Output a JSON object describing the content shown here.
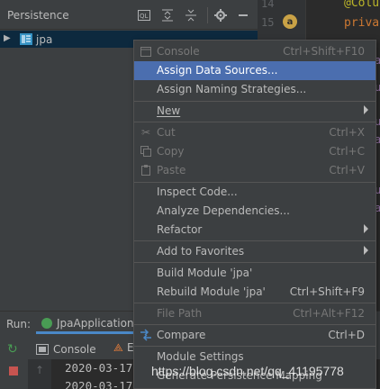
{
  "persistence": {
    "title": "Persistence",
    "tree_item": "jpa"
  },
  "editor": {
    "line_numbers": [
      "14",
      "15"
    ],
    "badge": "a",
    "code_line1": "@Colu",
    "code_line2": "priva",
    "edge_chars": [
      "u",
      "a",
      "u",
      "a",
      "u",
      "a"
    ]
  },
  "run": {
    "label": "Run:",
    "tab_label": "JpaApplication"
  },
  "console": {
    "tab_label": "Console",
    "endpoints_label": "E",
    "log_lines": [
      "2020-03-17",
      "2020-03-17"
    ]
  },
  "menu": {
    "items": [
      {
        "label": "Console",
        "shortcut": "Ctrl+Shift+F10",
        "icon": "console-icon"
      },
      {
        "label": "Assign Data Sources...",
        "shortcut": ""
      },
      {
        "label": "Assign Naming Strategies...",
        "shortcut": ""
      },
      {
        "label": "New",
        "shortcut": ""
      },
      {
        "label": "Cut",
        "shortcut": "Ctrl+X",
        "icon": "scissors-icon"
      },
      {
        "label": "Copy",
        "shortcut": "Ctrl+C",
        "icon": "copy-icon"
      },
      {
        "label": "Paste",
        "shortcut": "Ctrl+V",
        "icon": "paste-icon"
      },
      {
        "label": "Inspect Code...",
        "shortcut": ""
      },
      {
        "label": "Analyze Dependencies...",
        "shortcut": ""
      },
      {
        "label": "Refactor",
        "shortcut": ""
      },
      {
        "label": "Add to Favorites",
        "shortcut": ""
      },
      {
        "label": "Build Module 'jpa'",
        "shortcut": ""
      },
      {
        "label": "Rebuild Module 'jpa'",
        "shortcut": "Ctrl+Shift+F9"
      },
      {
        "label": "File Path",
        "shortcut": "Ctrl+Alt+F12"
      },
      {
        "label": "Compare",
        "shortcut": "Ctrl+D",
        "icon": "compare-icon"
      },
      {
        "label": "Module Settings",
        "shortcut": ""
      },
      {
        "label": "Generate Persistence Mapping",
        "shortcut": ""
      }
    ]
  },
  "watermark": "https://blog.csdn.net/qq_41195778",
  "colors": {
    "selection": "#4b6eaf",
    "tree_selection": "#0d293e",
    "panel": "#3c3f41",
    "editor_bg": "#2b2b2b"
  }
}
